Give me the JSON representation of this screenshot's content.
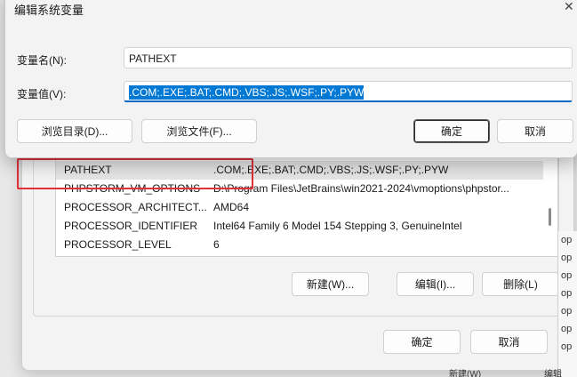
{
  "edit_dialog": {
    "title": "编辑系统变量",
    "name_label": "变量名(N):",
    "name_value": "PATHEXT",
    "value_label": "变量值(V):",
    "value_value": ".COM;.EXE;.BAT;.CMD;.VBS;.JS;.WSF;.PY;.PYW",
    "browse_dir_button": "浏览目录(D)...",
    "browse_file_button": "浏览文件(F)...",
    "ok_button": "确定",
    "cancel_button": "取消"
  },
  "env_dialog": {
    "variables": [
      {
        "name": "PATHEXT",
        "value": ".COM;.EXE;.BAT;.CMD;.VBS;.JS;.WSF;.PY;.PYW"
      },
      {
        "name": "PHPSTORM_VM_OPTIONS",
        "value": "D:\\Program Files\\JetBrains\\win2021-2024\\vmoptions\\phpstor..."
      },
      {
        "name": "PROCESSOR_ARCHITECT...",
        "value": "AMD64"
      },
      {
        "name": "PROCESSOR_IDENTIFIER",
        "value": "Intel64 Family 6 Model 154 Stepping 3, GenuineIntel"
      },
      {
        "name": "PROCESSOR_LEVEL",
        "value": "6"
      }
    ],
    "new_button": "新建(W)...",
    "edit_button": "编辑(I)...",
    "delete_button": "删除(L)",
    "ok_button": "确定",
    "cancel_button": "取消"
  },
  "background": {
    "right_strip": [
      "op",
      "op",
      "op",
      "op",
      "op",
      "op",
      "op"
    ],
    "bottom_left_fragment": "新建(W)",
    "bottom_right_fragment": "编辑"
  }
}
